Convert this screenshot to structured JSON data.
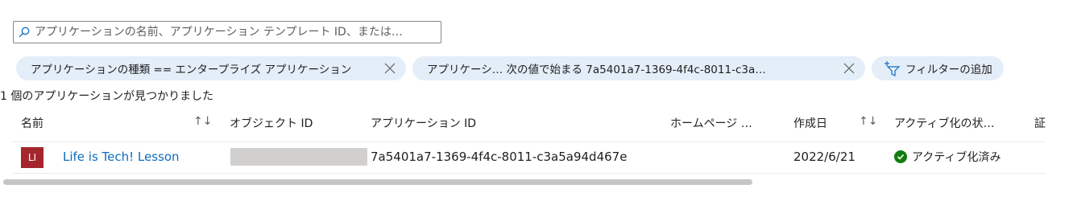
{
  "search": {
    "placeholder": "アプリケーションの名前、アプリケーション テンプレート ID、または…",
    "icon": "search-icon"
  },
  "filters": [
    {
      "label": "アプリケーションの種類 == エンタープライズ アプリケーション"
    },
    {
      "label": "アプリケーシ… 次の値で始まる 7a5401a7-1369-4f4c-8011-c3a…"
    }
  ],
  "add_filter_label": "フィルターの追加",
  "result_count": "1 個のアプリケーションが見つかりました",
  "columns": {
    "name": "名前",
    "sort_icon": "↑↓",
    "object_id": "オブジェクト ID",
    "app_id": "アプリケーション ID",
    "homepage": "ホームページ …",
    "created": "作成日",
    "activation": "アクティブ化の状…",
    "cut": "証"
  },
  "rows": [
    {
      "initials": "LI",
      "name": "Life is Tech! Lesson",
      "app_id": "7a5401a7-1369-4f4c-8011-c3a5a94d467e",
      "created": "2022/6/21",
      "status": "アクティブ化済み"
    }
  ],
  "colors": {
    "avatar": "#a4262c",
    "link": "#0f6cbd",
    "pill_bg": "#e4eef9",
    "success": "#107c10"
  }
}
